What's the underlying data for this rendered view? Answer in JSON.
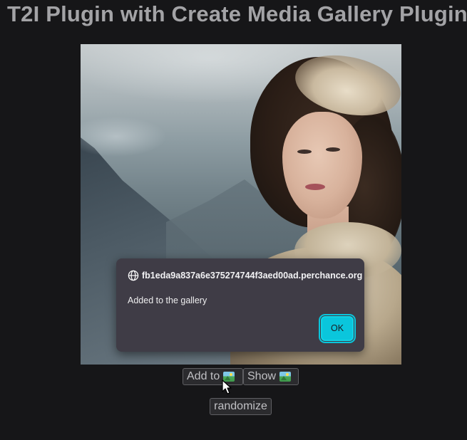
{
  "page": {
    "title": "T2I Plugin with Create Media Gallery Plugin"
  },
  "image": {
    "alt": "Portrait of a woman with curly hair and lace garments against a mountain backdrop"
  },
  "dialog": {
    "origin": "fb1eda9a837a6e375274744f3aed00ad.perchance.org",
    "message": "Added to the gallery",
    "ok_label": "OK",
    "globe_icon": "globe-icon",
    "accent_color": "#0ac6dc"
  },
  "controls": {
    "add_label": "Add to",
    "show_label": "Show",
    "picture_icon": "framed-picture-icon",
    "randomize_label": "randomize"
  }
}
